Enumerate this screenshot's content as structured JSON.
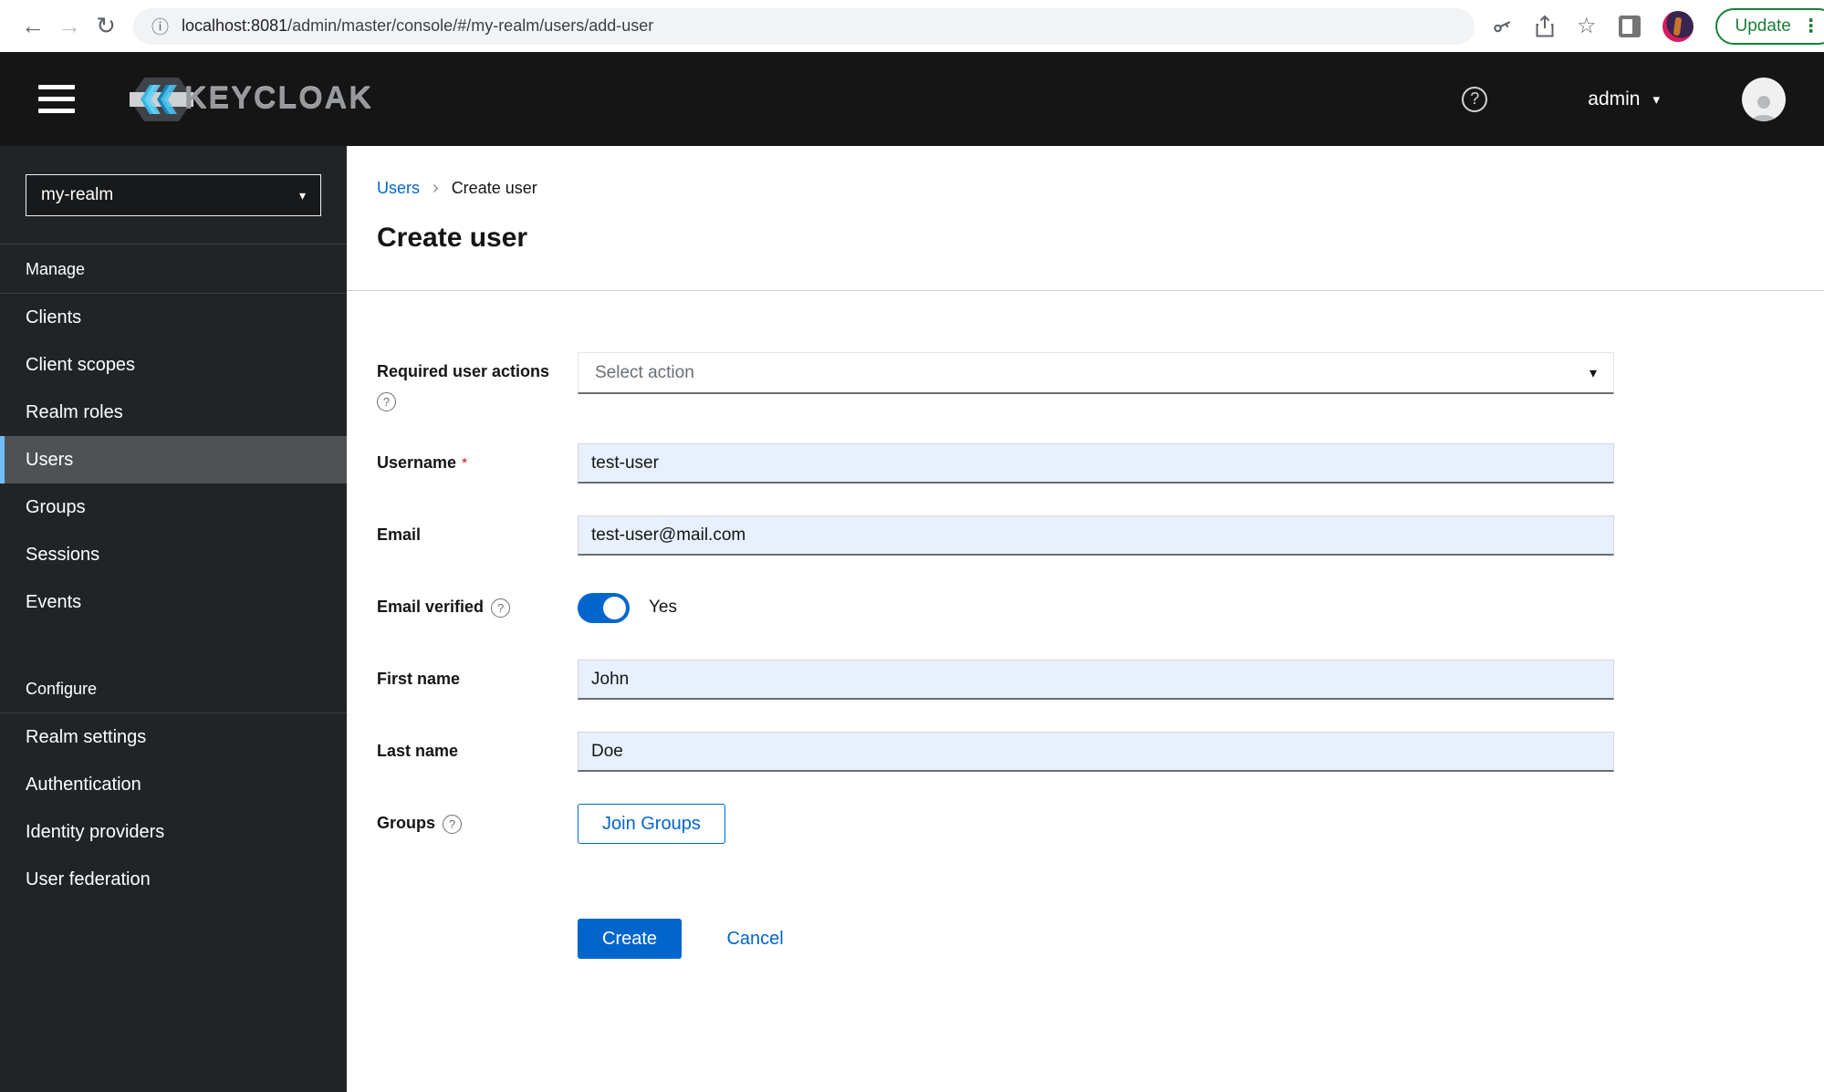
{
  "browser": {
    "url_host": "localhost:8081",
    "url_path": "/admin/master/console/#/my-realm/users/add-user",
    "update_label": "Update"
  },
  "header": {
    "brand": "KEYCLOAK",
    "username": "admin"
  },
  "sidebar": {
    "realm": "my-realm",
    "manage_label": "Manage",
    "manage_items": [
      "Clients",
      "Client scopes",
      "Realm roles",
      "Users",
      "Groups",
      "Sessions",
      "Events"
    ],
    "selected_item": "Users",
    "configure_label": "Configure",
    "configure_items": [
      "Realm settings",
      "Authentication",
      "Identity providers",
      "User federation"
    ]
  },
  "breadcrumb": {
    "parent": "Users",
    "current": "Create user"
  },
  "page": {
    "title": "Create user"
  },
  "form": {
    "required_user_actions": {
      "label": "Required user actions",
      "placeholder": "Select action"
    },
    "username": {
      "label": "Username",
      "value": "test-user"
    },
    "email": {
      "label": "Email",
      "value": "test-user@mail.com"
    },
    "email_verified": {
      "label": "Email verified",
      "state": "Yes"
    },
    "first_name": {
      "label": "First name",
      "value": "John"
    },
    "last_name": {
      "label": "Last name",
      "value": "Doe"
    },
    "groups": {
      "label": "Groups",
      "button_label": "Join Groups"
    }
  },
  "actions": {
    "create": "Create",
    "cancel": "Cancel"
  },
  "icons": {
    "back": "←",
    "forward": "→",
    "reload": "↻",
    "info": "ⓘ",
    "star": "☆",
    "kebab": "⋮",
    "caret_down": "▾",
    "breadcrumb_sep": "›",
    "help": "?",
    "asterisk": "*"
  },
  "colors": {
    "primary_blue": "#0066cc",
    "nav_selected_accent": "#73bcf7",
    "nav_selected_bg": "#4f5255",
    "sidebar_bg": "#212427",
    "header_bg": "#151515",
    "autofill_input_bg": "#e8f0fe",
    "required_red": "#c9190b",
    "update_green": "#1a7f37",
    "link_blue": "#0066cc"
  }
}
